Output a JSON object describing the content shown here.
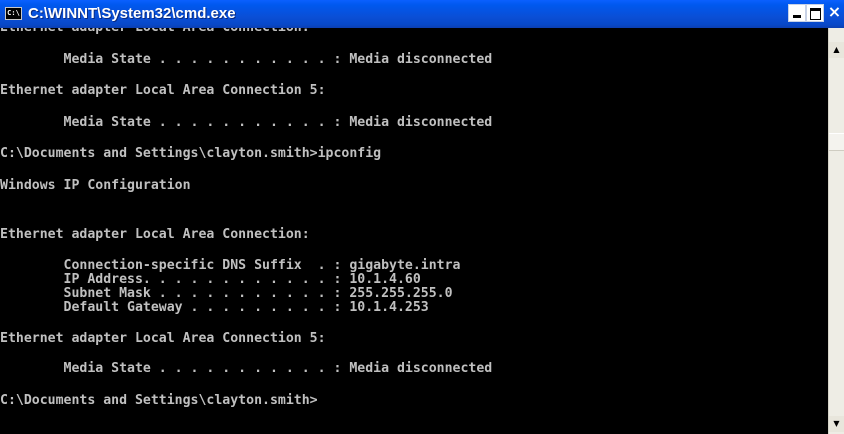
{
  "window": {
    "title": "C:\\WINNT\\System32\\cmd.exe",
    "icon_name": "console-app-icon",
    "icon_text": "C:\\",
    "minimize_icon": "minimize-icon",
    "maximize_icon": "maximize-icon",
    "close_glyph": "×"
  },
  "console": {
    "text_color": "#c0c0c0",
    "background": "#000000",
    "lines": [
      "Ethernet adapter Local Area Connection:",
      "",
      "        Media State . . . . . . . . . . . : Media disconnected",
      "",
      "Ethernet adapter Local Area Connection 5:",
      "",
      "        Media State . . . . . . . . . . . : Media disconnected",
      "",
      "C:\\Documents and Settings\\clayton.smith>ipconfig",
      "",
      "Windows IP Configuration",
      "",
      "",
      "Ethernet adapter Local Area Connection:",
      "",
      "        Connection-specific DNS Suffix  . : gigabyte.intra",
      "        IP Address. . . . . . . . . . . . : 10.1.4.60",
      "        Subnet Mask . . . . . . . . . . . : 255.255.255.0",
      "        Default Gateway . . . . . . . . . : 10.1.4.253",
      "",
      "Ethernet adapter Local Area Connection 5:",
      "",
      "        Media State . . . . . . . . . . . : Media disconnected",
      "",
      "C:\\Documents and Settings\\clayton.smith>"
    ]
  },
  "scrollbar": {
    "up_arrow": "▲",
    "down_arrow": "▼"
  }
}
